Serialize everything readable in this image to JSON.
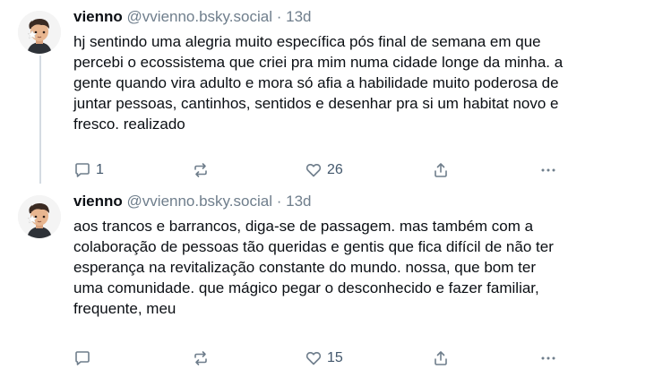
{
  "posts": [
    {
      "author": {
        "name": "vienno",
        "handle": "@vvienno.bsky.social"
      },
      "separator": "·",
      "time": "13d",
      "lines": [
        "hj sentindo uma alegria muito específica pós final de semana em que",
        "percebi o ecossistema que criei pra mim numa cidade longe da minha. a",
        "gente quando vira adulto e mora só afia a habilidade muito poderosa de",
        "juntar pessoas, cantinhos, sentidos e desenhar pra si um habitat novo e",
        "fresco. realizado"
      ],
      "reply_count": "1",
      "repost_count": "",
      "like_count": "26"
    },
    {
      "author": {
        "name": "vienno",
        "handle": "@vvienno.bsky.social"
      },
      "separator": "·",
      "time": "13d",
      "lines": [
        "aos trancos e barrancos, diga-se de passagem. mas também com a",
        "colaboração de pessoas tão queridas e gentis que fica difícil de não ter",
        "esperança na revitalização constante do mundo. nossa, que bom ter",
        "uma comunidade. que mágico pegar o desconhecido e fazer familiar,",
        "frequente, meu"
      ],
      "reply_count": "",
      "repost_count": "",
      "like_count": "15"
    }
  ],
  "icons": {
    "reply": "speech-bubble-icon",
    "repost": "repost-arrows-icon",
    "like": "heart-outline-icon",
    "share": "share-upload-icon",
    "more": "ellipsis-icon"
  },
  "colors": {
    "text": "#0b0f14",
    "muted": "#6f7e8c",
    "count": "#42576c",
    "thread_line": "#d4dbe2",
    "background": "#ffffff"
  }
}
